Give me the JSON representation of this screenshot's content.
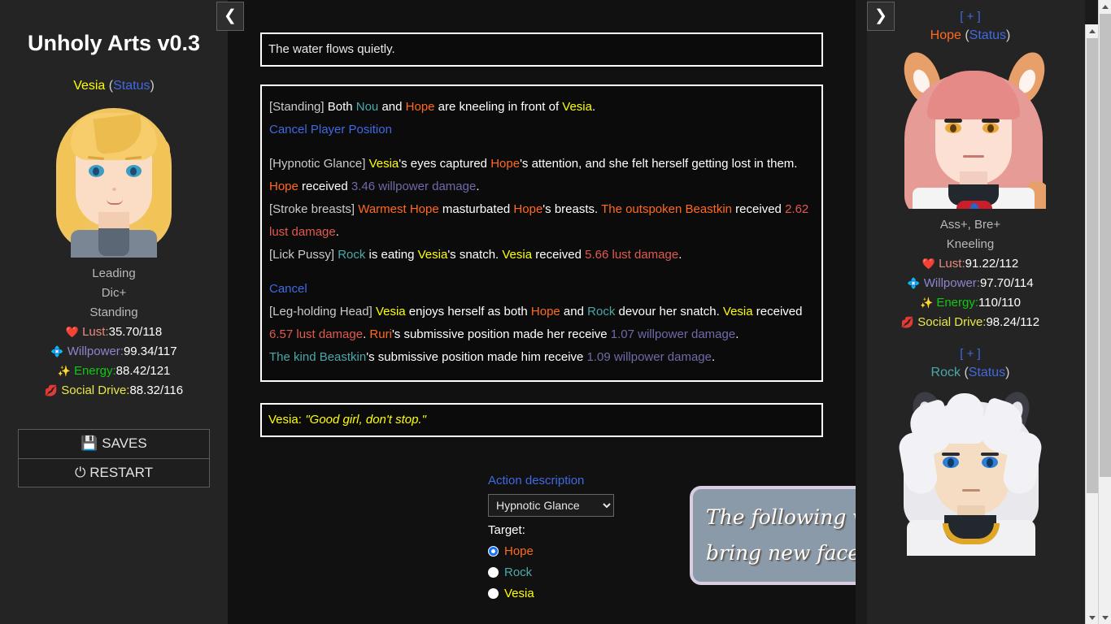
{
  "app": {
    "title": "Unholy Arts v0.3"
  },
  "nav": {
    "collapse_left": "❮",
    "collapse_right": "❯"
  },
  "player": {
    "name": "Vesia",
    "status_label": "Status",
    "traits": "Leading",
    "size": "Dic+",
    "position": "Standing",
    "stats": [
      {
        "icon": "❤️",
        "icon_name": "heart-icon",
        "label": "Lust:",
        "value": "35.70/118",
        "color": "#ea8a82"
      },
      {
        "icon": "💠",
        "icon_name": "diamond-icon",
        "label": "Willpower:",
        "value": "99.34/117",
        "color": "#8b85cc"
      },
      {
        "icon": "✨",
        "icon_name": "sparkles-icon",
        "label": "Energy:",
        "value": "88.42/121",
        "color": "#11c911"
      },
      {
        "icon": "💋",
        "icon_name": "lips-icon",
        "label": "Social Drive:",
        "value": "88.32/116",
        "color": "#e8e84a"
      }
    ],
    "buttons": [
      {
        "icon": "💾",
        "icon_name": "floppy-disk-icon",
        "label": "SAVES"
      },
      {
        "icon": "⏻",
        "icon_name": "power-icon",
        "label": "RESTART"
      }
    ]
  },
  "status_message": "The water flows quietly.",
  "log": [
    {
      "type": "line",
      "parts": [
        {
          "t": "[Standing] ",
          "c": "tag"
        },
        {
          "t": "Both ",
          "c": "white"
        },
        {
          "t": "Nou",
          "c": "teal"
        },
        {
          "t": " and ",
          "c": "white"
        },
        {
          "t": "Hope",
          "c": "orange"
        },
        {
          "t": " are kneeling in front of ",
          "c": "white"
        },
        {
          "t": "Vesia",
          "c": "yellow"
        },
        {
          "t": ".",
          "c": "white"
        }
      ]
    },
    {
      "type": "link",
      "label": "Cancel Player Position"
    },
    {
      "type": "spacer"
    },
    {
      "type": "line",
      "parts": [
        {
          "t": "[Hypnotic Glance] ",
          "c": "tag"
        },
        {
          "t": "Vesia",
          "c": "yellow"
        },
        {
          "t": "'s eyes captured ",
          "c": "white"
        },
        {
          "t": "Hope",
          "c": "orange"
        },
        {
          "t": "'s attention, and she felt herself getting lost in them.",
          "c": "white"
        }
      ]
    },
    {
      "type": "line",
      "parts": [
        {
          "t": "Hope",
          "c": "orange"
        },
        {
          "t": " received ",
          "c": "white"
        },
        {
          "t": "3.46 willpower damage",
          "c": "dmg-wil"
        },
        {
          "t": ".",
          "c": "white"
        }
      ]
    },
    {
      "type": "line",
      "parts": [
        {
          "t": "[Stroke breasts] ",
          "c": "tag"
        },
        {
          "t": "Warmest Hope",
          "c": "orange"
        },
        {
          "t": " masturbated ",
          "c": "white"
        },
        {
          "t": "Hope",
          "c": "orange"
        },
        {
          "t": "'s breasts. ",
          "c": "white"
        },
        {
          "t": "The outspoken Beastkin",
          "c": "orange"
        },
        {
          "t": " received ",
          "c": "white"
        },
        {
          "t": "2.62 lust damage",
          "c": "dmg-red"
        },
        {
          "t": ".",
          "c": "white"
        }
      ]
    },
    {
      "type": "line",
      "parts": [
        {
          "t": "[Lick Pussy] ",
          "c": "tag"
        },
        {
          "t": "Rock",
          "c": "teal"
        },
        {
          "t": " is eating ",
          "c": "white"
        },
        {
          "t": "Vesia",
          "c": "yellow"
        },
        {
          "t": "'s snatch. ",
          "c": "white"
        },
        {
          "t": "Vesia",
          "c": "yellow"
        },
        {
          "t": " received ",
          "c": "white"
        },
        {
          "t": "5.66 lust damage",
          "c": "dmg-red"
        },
        {
          "t": ".",
          "c": "white"
        }
      ]
    },
    {
      "type": "spacer"
    },
    {
      "type": "link",
      "label": "Cancel"
    },
    {
      "type": "line",
      "parts": [
        {
          "t": "[Leg-holding Head] ",
          "c": "tag"
        },
        {
          "t": "Vesia",
          "c": "yellow"
        },
        {
          "t": " enjoys herself as both ",
          "c": "white"
        },
        {
          "t": "Hope",
          "c": "orange"
        },
        {
          "t": " and ",
          "c": "white"
        },
        {
          "t": "Rock",
          "c": "teal"
        },
        {
          "t": " devour her snatch. ",
          "c": "white"
        },
        {
          "t": "Vesia",
          "c": "yellow"
        },
        {
          "t": " received ",
          "c": "white"
        },
        {
          "t": "6.57 lust damage",
          "c": "dmg-red"
        },
        {
          "t": ". ",
          "c": "white"
        },
        {
          "t": "Ruri",
          "c": "orange"
        },
        {
          "t": "'s submissive position made her receive ",
          "c": "white"
        },
        {
          "t": "1.07 willpower damage",
          "c": "dmg-wil"
        },
        {
          "t": ".",
          "c": "white"
        }
      ]
    },
    {
      "type": "line",
      "parts": [
        {
          "t": "The kind Beastkin",
          "c": "teal"
        },
        {
          "t": "'s submissive position made him receive ",
          "c": "white"
        },
        {
          "t": "1.09 willpower damage",
          "c": "dmg-wil"
        },
        {
          "t": ".",
          "c": "white"
        }
      ]
    }
  ],
  "dialogue": {
    "speaker": "Vesia:",
    "quote": "\"Good girl, don't stop.\""
  },
  "controls": {
    "action_description_label": "Action description",
    "selected_action": "Hypnotic Glance",
    "action_options": [
      "Hypnotic Glance"
    ],
    "target_label": "Target:",
    "targets": [
      {
        "name": "Hope",
        "color": "orange",
        "selected": true
      },
      {
        "name": "Rock",
        "color": "teal",
        "selected": false
      },
      {
        "name": "Vesia",
        "color": "yellow",
        "selected": false
      }
    ]
  },
  "notice": {
    "lines": [
      "The following versions will soon",
      "bring new faces! Stay updated"
    ],
    "background": "#8b9aa8",
    "border": "#d9cde2"
  },
  "right_characters": [
    {
      "expand": "[ + ]",
      "name": "Hope",
      "name_color": "#ff6a1e",
      "status_label": "Status",
      "traits": "Ass+, Bre+",
      "position": "Kneeling",
      "stats": [
        {
          "icon": "❤️",
          "icon_name": "heart-icon",
          "label": "Lust:",
          "value": "91.22/112",
          "color": "#ea8a82"
        },
        {
          "icon": "💠",
          "icon_name": "diamond-icon",
          "label": "Willpower:",
          "value": "97.70/114",
          "color": "#8b85cc"
        },
        {
          "icon": "✨",
          "icon_name": "sparkles-icon",
          "label": "Energy:",
          "value": "110/110",
          "color": "#11c911"
        },
        {
          "icon": "💋",
          "icon_name": "lips-icon",
          "label": "Social Drive:",
          "value": "98.24/112",
          "color": "#e8e84a"
        }
      ]
    },
    {
      "expand": "[ + ]",
      "name": "Rock",
      "name_color": "#4ca8a8",
      "status_label": "Status",
      "traits": "",
      "position": "",
      "stats": []
    }
  ]
}
